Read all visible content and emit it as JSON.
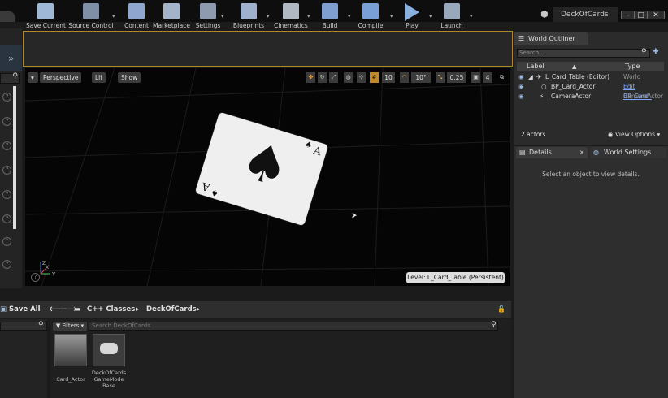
{
  "window": {
    "project_name": "DeckOfCards",
    "minimize": "–",
    "maximize": "□",
    "close": "✕"
  },
  "toolbar": {
    "buttons": [
      {
        "label": "Save Current",
        "icon": "save-icon",
        "color": "#9fb8d8"
      },
      {
        "label": "Source Control",
        "icon": "source-control-icon",
        "color": "#7f8fa6"
      },
      {
        "label": "Content",
        "icon": "content-icon",
        "color": "#8fa7cf"
      },
      {
        "label": "Marketplace",
        "icon": "marketplace-icon",
        "color": "#a3b3c9"
      },
      {
        "label": "Settings",
        "icon": "settings-icon",
        "color": "#8e9ab0"
      },
      {
        "label": "Blueprints",
        "icon": "blueprints-icon",
        "color": "#9fb0cc"
      },
      {
        "label": "Cinematics",
        "icon": "cinematics-icon",
        "color": "#b0b8c4"
      },
      {
        "label": "Build",
        "icon": "build-icon",
        "color": "#7f9fd0"
      },
      {
        "label": "Compile",
        "icon": "compile-icon",
        "color": "#7aa0d8"
      },
      {
        "label": "Play",
        "icon": "play-icon",
        "color": "#8ab0e0"
      },
      {
        "label": "Launch",
        "icon": "launch-icon",
        "color": "#9aa8bb"
      }
    ]
  },
  "viewport": {
    "menu_arrow": "▾",
    "perspective": "Perspective",
    "lit": "Lit",
    "show": "Show",
    "grid_snap": "10",
    "rotation_snap": "10°",
    "scale_snap": "0.25",
    "camera_speed": "4",
    "level_label": "Level:  L_Card_Table (Persistent)",
    "card": {
      "rank": "A",
      "suit": "♠"
    },
    "axis_x": "X",
    "axis_y": "Y",
    "axis_z": "Z"
  },
  "content_browser": {
    "save_all": "Save All",
    "path": [
      "C++ Classes",
      "DeckOfCards"
    ],
    "filters": "Filters",
    "search_placeholder": "Search DeckOfCards",
    "assets": [
      {
        "label": "Card_Actor"
      },
      {
        "label": "DeckOfCards GameMode Base"
      }
    ]
  },
  "world_outliner": {
    "tab": "World Outliner",
    "search_placeholder": "Search...",
    "col_label": "Label",
    "col_type": "Type",
    "rows": [
      {
        "label": "L_Card_Table (Editor)",
        "type": "World"
      },
      {
        "label": "BP_Card_Actor",
        "type": "Edit BP_Card_"
      },
      {
        "label": "CameraActor",
        "type": "CameraActor"
      }
    ],
    "count": "2 actors",
    "view_options": "View Options"
  },
  "details": {
    "tab_details": "Details",
    "tab_world_settings": "World Settings",
    "empty_message": "Select an object to view details."
  }
}
